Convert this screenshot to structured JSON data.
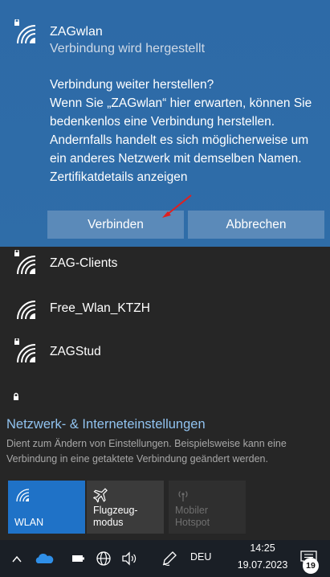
{
  "selected_network": {
    "name": "ZAGwlan",
    "status": "Verbindung wird hergestellt",
    "message_lines": [
      "Verbindung weiter herstellen?",
      "Wenn Sie „ZAGwlan“ hier erwarten, können Sie",
      "bedenkenlos eine Verbindung herstellen.",
      "Andernfalls handelt es sich möglicherweise um",
      "ein anderes Netzwerk mit demselben Namen.",
      "Zertifikatdetails anzeigen"
    ],
    "connect_label": "Verbinden",
    "cancel_label": "Abbrechen",
    "icon": "wifi-secured-icon"
  },
  "networks": [
    {
      "name": "ZAG-Clients",
      "icon": "wifi-secured-icon"
    },
    {
      "name": "Free_Wlan_KTZH",
      "icon": "wifi-icon"
    },
    {
      "name": "ZAGStud",
      "icon": "wifi-secured-icon"
    }
  ],
  "settings": {
    "link": "Netzwerk- & Interneteinstellungen",
    "description": "Dient zum Ändern von Einstellungen. Beispielsweise kann eine Verbindung in eine getaktete Verbindung geändert werden."
  },
  "quick_actions": [
    {
      "label": "WLAN",
      "icon": "wifi-icon",
      "state": "on"
    },
    {
      "label_lines": [
        "Flugzeug-",
        "modus"
      ],
      "icon": "airplane-icon",
      "state": "off"
    },
    {
      "label_lines": [
        "Mobiler",
        "Hotspot"
      ],
      "icon": "hotspot-icon",
      "state": "disabled"
    }
  ],
  "taskbar": {
    "language": "DEU",
    "time": "14:25",
    "date": "19.07.2023",
    "notification_count": "19"
  },
  "colors": {
    "selected_bg": "#2f6da8",
    "button_bg": "#5b8ab9",
    "link": "#91c3f0",
    "wlan_tile": "#1f72c7",
    "flyout_bg": "#262626",
    "taskbar_bg": "#1a1f26",
    "annotation_arrow": "#e02020"
  }
}
